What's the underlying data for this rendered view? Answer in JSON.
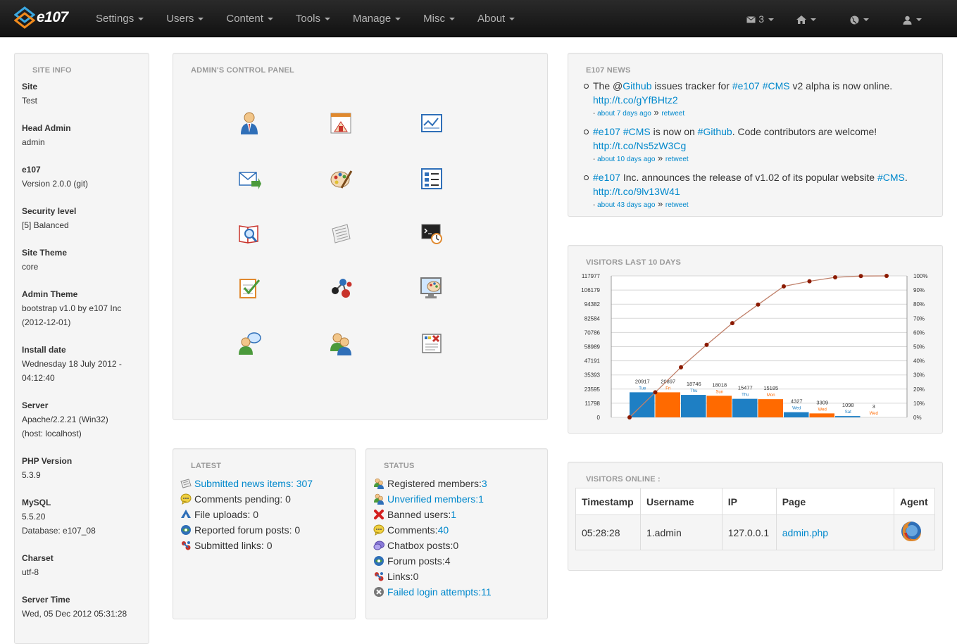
{
  "brand": {
    "name": "e107"
  },
  "nav": {
    "menus": [
      "Settings",
      "Users",
      "Content",
      "Tools",
      "Manage",
      "Misc",
      "About"
    ],
    "messages_count": "3"
  },
  "site_info": {
    "title": "SITE INFO",
    "rows": [
      {
        "label": "Site",
        "value": "Test"
      },
      {
        "label": "Head Admin",
        "value": "admin"
      },
      {
        "label": "e107",
        "value": "Version 2.0.0 (git)"
      },
      {
        "label": "Security level",
        "value": "[5] Balanced"
      },
      {
        "label": "Site Theme",
        "value": "core"
      },
      {
        "label": "Admin Theme",
        "value": "bootstrap v1.0 by e107 Inc",
        "value2": "(2012-12-01)"
      },
      {
        "label": "Install date",
        "value": "Wednesday 18 July 2012 -",
        "value2": "04:12:40"
      },
      {
        "label": "Server",
        "value": "Apache/2.2.21 (Win32)",
        "value2": "(host: localhost)"
      },
      {
        "label": "PHP Version",
        "value": "5.3.9"
      },
      {
        "label": "MySQL",
        "value": "5.5.20",
        "value2": "Database: e107_08"
      },
      {
        "label": "Charset",
        "value": "utf-8"
      },
      {
        "label": "Server Time",
        "value": "Wed, 05 Dec 2012 05:31:28"
      }
    ]
  },
  "control_panel": {
    "title": "ADMIN'S CONTROL PANEL",
    "icons": [
      "admin-user-icon",
      "frontpage-icon",
      "news-icon",
      "mail-icon",
      "theme-palette-icon",
      "menus-icon",
      "search-icon",
      "newspaper-icon",
      "cron-icon",
      "checklist-icon",
      "plugins-molecule-icon",
      "theme-manager-icon",
      "chatbox-icon",
      "users-icon",
      "notify-icon"
    ],
    "icon_colors": {
      "blue": "#2f6fb8",
      "orange": "#e0892e",
      "red": "#c8332b",
      "green": "#4b9a3b"
    }
  },
  "news": {
    "title": "E107 NEWS",
    "items": [
      {
        "segments": [
          {
            "t": "The @",
            "link": false
          },
          {
            "t": "Github",
            "link": true
          },
          {
            "t": " issues tracker for ",
            "link": false
          },
          {
            "t": "#e107",
            "link": true
          },
          {
            "t": " ",
            "link": false
          },
          {
            "t": "#CMS",
            "link": true
          },
          {
            "t": " v2 alpha is now online. ",
            "link": false
          },
          {
            "t": "http://t.co/gYfBHtz2",
            "link": true
          }
        ],
        "ago": "about 7 days ago",
        "retweet": "retweet"
      },
      {
        "segments": [
          {
            "t": "#e107",
            "link": true
          },
          {
            "t": " ",
            "link": false
          },
          {
            "t": "#CMS",
            "link": true
          },
          {
            "t": " is now on ",
            "link": false
          },
          {
            "t": "#Github",
            "link": true
          },
          {
            "t": ". Code contributors are welcome! ",
            "link": false
          },
          {
            "t": "http://t.co/Ns5zW3Cg",
            "link": true
          }
        ],
        "ago": "about 10 days ago",
        "retweet": "retweet"
      },
      {
        "segments": [
          {
            "t": "#e107",
            "link": true
          },
          {
            "t": " Inc. announces the release of v1.02 of its popular website ",
            "link": false
          },
          {
            "t": "#CMS",
            "link": true
          },
          {
            "t": ". ",
            "link": false
          },
          {
            "t": "http://t.co/9lv13W41",
            "link": true
          }
        ],
        "ago": "about 43 days ago",
        "retweet": "retweet"
      }
    ],
    "separator": "»",
    "dash": "-"
  },
  "visitors_chart": {
    "title": "VISITORS LAST 10 DAYS"
  },
  "chart_data": {
    "type": "bar",
    "categories": [
      "Tue",
      "Fri",
      "Thu",
      "Sun",
      "Thu",
      "Mon",
      "Wed",
      "Wed",
      "Sat",
      "Wed"
    ],
    "values": [
      20917,
      20897,
      18746,
      18018,
      15477,
      15185,
      4327,
      3309,
      1098,
      3
    ],
    "bar_colors": [
      "#1e7fc4",
      "#ff6a00",
      "#1e7fc4",
      "#ff6a00",
      "#1e7fc4",
      "#ff6a00",
      "#1e7fc4",
      "#ff6a00",
      "#1e7fc4",
      "#ff6a00"
    ],
    "cumulative_percent": [
      0,
      17.7,
      35.4,
      51.3,
      66.6,
      79.7,
      92.6,
      96.2,
      99.0,
      99.9,
      100
    ],
    "y_ticks": [
      "0",
      "11798",
      "23595",
      "35393",
      "47191",
      "58989",
      "70786",
      "82584",
      "94382",
      "106179",
      "117977"
    ],
    "y2_ticks": [
      "0%",
      "10%",
      "20%",
      "30%",
      "40%",
      "50%",
      "60%",
      "70%",
      "80%",
      "90%",
      "100%"
    ],
    "ylim": [
      0,
      117977
    ],
    "line_color": "#c0806a",
    "point_color": "#8b1a00"
  },
  "latest": {
    "title": "LATEST",
    "items": [
      {
        "icon": "news-item-icon",
        "label": "Submitted news items: 307",
        "link": true
      },
      {
        "icon": "comment-icon",
        "label": "Comments pending: 0",
        "link": false
      },
      {
        "icon": "upload-icon",
        "label": "File uploads: 0",
        "link": false
      },
      {
        "icon": "forum-icon",
        "label": "Reported forum posts: 0",
        "link": false
      },
      {
        "icon": "link-icon",
        "label": "Submitted links: 0",
        "link": false
      }
    ]
  },
  "status": {
    "title": "STATUS",
    "items": [
      {
        "icon": "users-icon",
        "label": "Registered members: ",
        "value": "3",
        "link": false
      },
      {
        "icon": "users-icon",
        "label": "Unverified members: ",
        "value": "1",
        "link": true
      },
      {
        "icon": "banned-icon",
        "label": "Banned users: ",
        "value": "1",
        "link": false
      },
      {
        "icon": "comment-icon",
        "label": "Comments: ",
        "value": "40",
        "link": false
      },
      {
        "icon": "chatbox-icon",
        "label": "Chatbox posts: ",
        "value": "0",
        "link": false,
        "plain": true
      },
      {
        "icon": "forum-icon",
        "label": "Forum posts: ",
        "value": "4",
        "link": false,
        "plain": true
      },
      {
        "icon": "link-icon",
        "label": "Links: ",
        "value": "0",
        "link": false,
        "plain": true
      },
      {
        "icon": "failed-login-icon",
        "label": "Failed login attempts: ",
        "value": "11",
        "link": true
      }
    ]
  },
  "visitors_online": {
    "title": "VISITORS ONLINE :",
    "columns": [
      "Timestamp",
      "Username",
      "IP",
      "Page",
      "Agent"
    ],
    "rows": [
      {
        "timestamp": "05:28:28",
        "username": "1.admin",
        "ip": "127.0.0.1",
        "page": "admin.php",
        "agent": "firefox-icon"
      }
    ]
  }
}
